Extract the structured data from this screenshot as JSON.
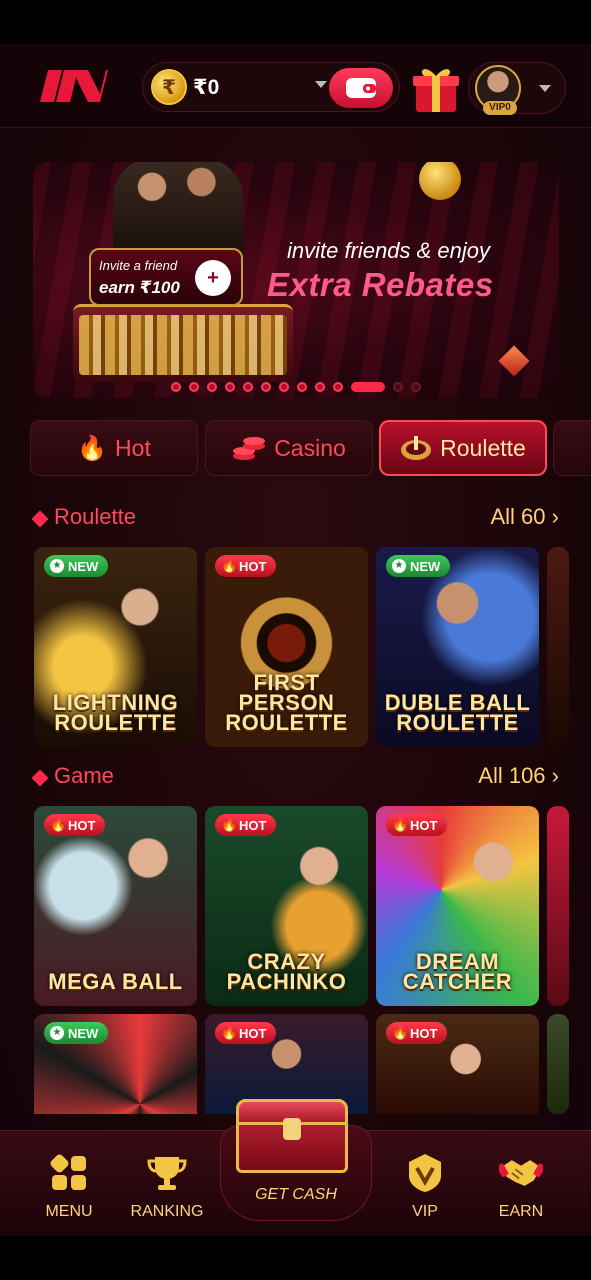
{
  "header": {
    "balance": "₹0",
    "coin_symbol": "₹",
    "vip_label": "VIP0"
  },
  "banner": {
    "card_line1": "Invite a friend",
    "card_line2": "earn ₹100",
    "subtitle": "invite friends & enjoy",
    "headline": "Extra Rebates",
    "slide_count": 13,
    "active_slide": 10
  },
  "tabs": [
    {
      "label": "Hot",
      "icon": "flame-icon"
    },
    {
      "label": "Casino",
      "icon": "chips-icon"
    },
    {
      "label": "Roulette",
      "icon": "roulette-icon",
      "active": true
    }
  ],
  "sections": {
    "roulette": {
      "title": "Roulette",
      "all_label": "All 60",
      "cards": [
        {
          "name_line1": "LIGHTNING",
          "name_line2": "ROULETTE",
          "badge": "NEW"
        },
        {
          "name_line1": "FIRST PERSON",
          "name_line2": "ROULETTE",
          "badge": "HOT"
        },
        {
          "name_line1": "DUBLE BALL",
          "name_line2": "ROULETTE",
          "badge": "NEW"
        }
      ]
    },
    "game": {
      "title": "Game",
      "all_label": "All 106",
      "cards": [
        {
          "name_line1": "",
          "name_line2": "MEGA BALL",
          "badge": "HOT"
        },
        {
          "name_line1": "CRAZY",
          "name_line2": "PACHINKO",
          "badge": "HOT"
        },
        {
          "name_line1": "DREAM",
          "name_line2": "CATCHER",
          "badge": "HOT"
        },
        {
          "name_line1": "",
          "name_line2": "",
          "badge": "NEW"
        },
        {
          "name_line1": "",
          "name_line2": "",
          "badge": "HOT"
        },
        {
          "name_line1": "",
          "name_line2": "",
          "badge": "HOT"
        }
      ]
    }
  },
  "nav": {
    "menu": "MENU",
    "ranking": "RANKING",
    "get_cash": "GET CASH",
    "vip": "VIP",
    "earn": "EARN"
  },
  "colors": {
    "accent": "#ff2a4a",
    "gold": "#ffd37a",
    "background": "#1a0508"
  }
}
